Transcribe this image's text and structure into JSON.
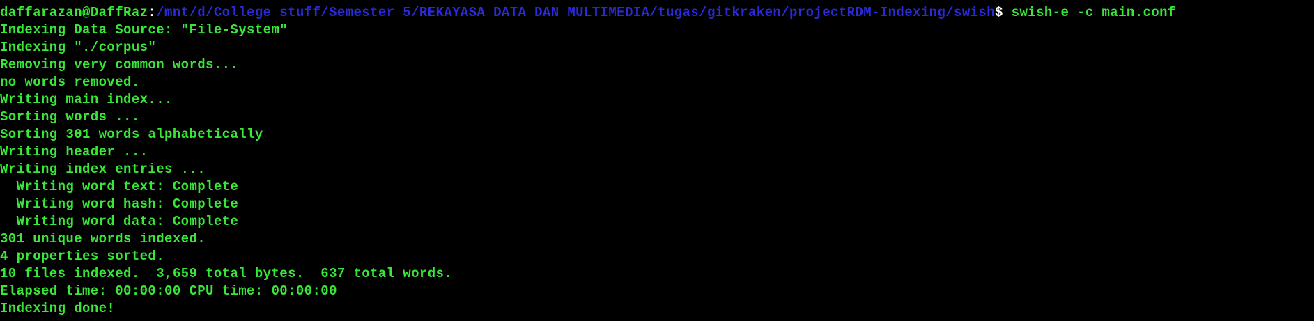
{
  "prompt": {
    "user_host": "daffarazan@DaffRaz",
    "separator": ":",
    "path": "/mnt/d/College stuff/Semester 5/REKAYASA DATA DAN MULTIMEDIA/tugas/gitkraken/projectRDM-Indexing/swish",
    "dollar": "$",
    "command": " swish-e -c main.conf"
  },
  "output_lines": [
    "Indexing Data Source: \"File-System\"",
    "Indexing \"./corpus\"",
    "Removing very common words...",
    "no words removed.",
    "Writing main index...",
    "Sorting words ...",
    "Sorting 301 words alphabetically",
    "Writing header ...",
    "Writing index entries ...",
    "  Writing word text: Complete",
    "  Writing word hash: Complete",
    "  Writing word data: Complete",
    "301 unique words indexed.",
    "4 properties sorted.",
    "10 files indexed.  3,659 total bytes.  637 total words.",
    "Elapsed time: 00:00:00 CPU time: 00:00:00",
    "Indexing done!"
  ],
  "colors": {
    "background": "#000000",
    "text_green": "#37e837",
    "path_blue": "#2a2ad8"
  }
}
